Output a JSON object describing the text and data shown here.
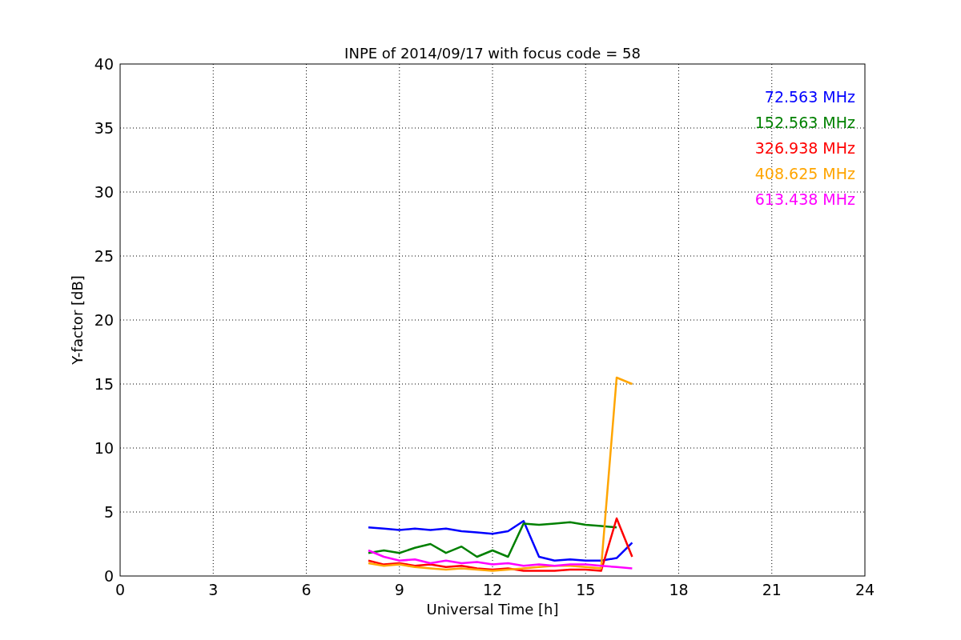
{
  "chart_data": {
    "type": "line",
    "title": "INPE of 2014/09/17 with focus code = 58",
    "xlabel": "Universal Time [h]",
    "ylabel": "Y-factor [dB]",
    "x": [
      8,
      8.5,
      9,
      9.5,
      10,
      10.5,
      11,
      11.5,
      12,
      12.5,
      13,
      13.5,
      14,
      14.5,
      15,
      15.5,
      16,
      16.5
    ],
    "series": [
      {
        "name": "72.563 MHz",
        "color": "#0000ff",
        "values": [
          3.8,
          3.7,
          3.6,
          3.7,
          3.6,
          3.7,
          3.5,
          3.4,
          3.3,
          3.5,
          4.3,
          1.5,
          1.2,
          1.3,
          1.2,
          1.2,
          1.4,
          2.6
        ]
      },
      {
        "name": "152.563 MHz",
        "color": "#008000",
        "values": [
          1.8,
          2.0,
          1.8,
          2.2,
          2.5,
          1.8,
          2.3,
          1.5,
          2.0,
          1.5,
          4.1,
          4.0,
          4.1,
          4.2,
          4.0,
          3.9,
          3.8,
          null
        ]
      },
      {
        "name": "326.938 MHz",
        "color": "#ff0000",
        "values": [
          1.2,
          0.9,
          1.0,
          0.8,
          0.9,
          0.7,
          0.8,
          0.6,
          0.5,
          0.6,
          0.4,
          0.4,
          0.4,
          0.5,
          0.5,
          0.4,
          4.5,
          1.5
        ]
      },
      {
        "name": "408.625 MHz",
        "color": "#ffa500",
        "values": [
          1.0,
          0.8,
          0.9,
          0.7,
          0.6,
          0.5,
          0.6,
          0.5,
          0.4,
          0.5,
          0.6,
          0.7,
          0.8,
          0.8,
          0.7,
          0.6,
          15.5,
          15.0
        ]
      },
      {
        "name": "613.438 MHz",
        "color": "#ff00ff",
        "values": [
          2.0,
          1.5,
          1.2,
          1.3,
          1.0,
          1.2,
          1.0,
          1.1,
          0.9,
          1.0,
          0.8,
          0.9,
          0.8,
          0.9,
          0.9,
          0.8,
          0.7,
          0.6
        ]
      }
    ],
    "xlim": [
      0,
      24
    ],
    "ylim": [
      0,
      40
    ],
    "xticks": [
      0,
      3,
      6,
      9,
      12,
      15,
      18,
      21,
      24
    ],
    "yticks": [
      0,
      5,
      10,
      15,
      20,
      25,
      30,
      35,
      40
    ],
    "grid": true
  }
}
